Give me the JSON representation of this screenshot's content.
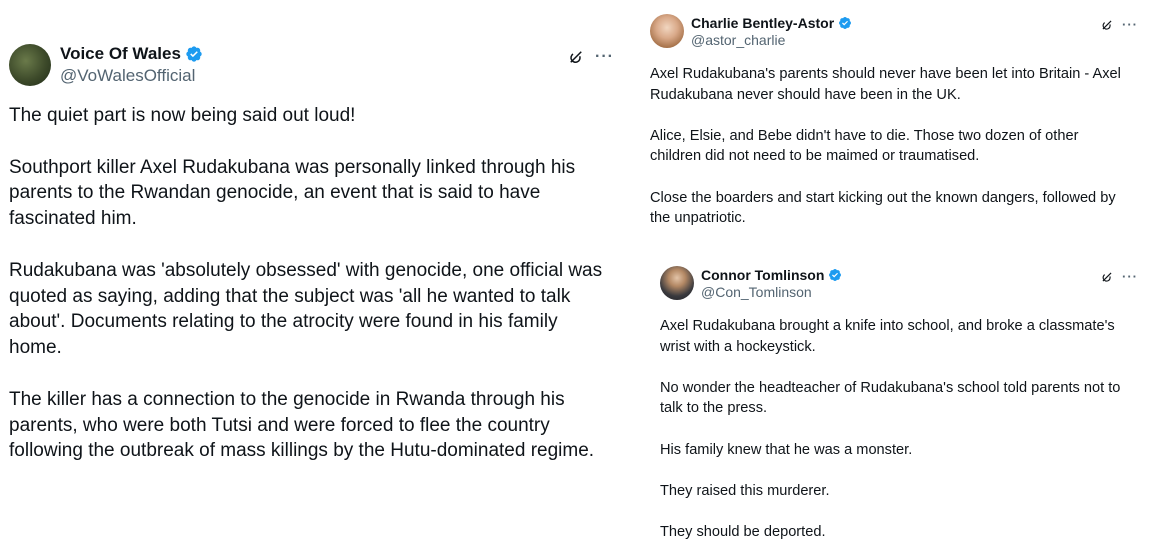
{
  "tweets": {
    "left": {
      "display_name": "Voice Of Wales",
      "handle": "@VoWalesOfficial",
      "verified_color": "#1d9bf0",
      "icons": {
        "grok": "grok-icon",
        "more": "more-options-icon"
      },
      "more_label": "···",
      "paragraphs": [
        "The quiet part is now being said out loud!",
        "Southport killer Axel Rudakubana was personally linked through his\nparents to the Rwandan genocide, an event that is said to have\nfascinated him.",
        "Rudakubana was 'absolutely obsessed' with genocide, one official was\nquoted as saying, adding that the subject was 'all he wanted to talk\nabout'. Documents relating to the atrocity were found in his family\nhome.",
        "The killer has a connection to the genocide in Rwanda through his\nparents, who were both Tutsi and were forced to flee the country\nfollowing the outbreak of mass killings by the Hutu-dominated regime."
      ]
    },
    "right_top": {
      "display_name": "Charlie Bentley-Astor",
      "handle": "@astor_charlie",
      "more_label": "···",
      "paragraphs": [
        "Axel Rudakubana's parents should never have been let into Britain - Axel\nRudakubana never should have been in the UK.",
        "Alice, Elsie, and Bebe didn't have to die. Those two dozen of other\nchildren did not need to be maimed or traumatised.",
        "Close the boarders and start kicking out the known dangers, followed by\nthe unpatriotic."
      ]
    },
    "right_bottom": {
      "display_name": "Connor Tomlinson",
      "handle": "@Con_Tomlinson",
      "more_label": "···",
      "paragraphs": [
        "Axel Rudakubana brought a knife into school, and broke a classmate's\nwrist with a hockeystick.",
        "No wonder the headteacher of Rudakubana's school told parents not to\ntalk to the press.",
        "His family knew that he was a monster.",
        "They raised this murderer.",
        "They should be deported."
      ]
    }
  }
}
